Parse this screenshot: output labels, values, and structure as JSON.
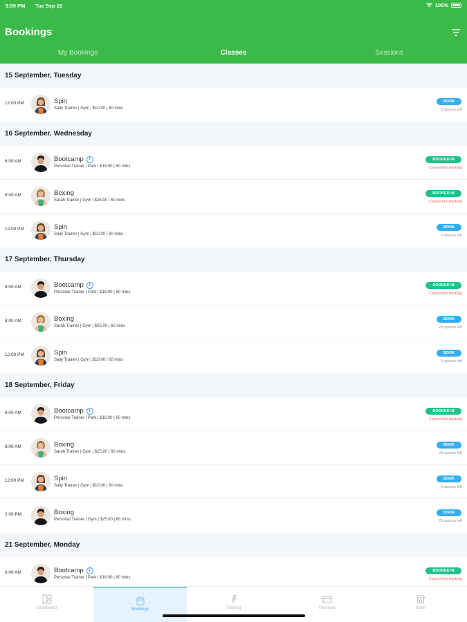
{
  "status_bar": {
    "time": "5:50 PM",
    "date": "Tue Sep 15",
    "battery": "100%"
  },
  "header": {
    "title": "Bookings"
  },
  "tabs": [
    {
      "label": "My Bookings",
      "active": false
    },
    {
      "label": "Classes",
      "active": true
    },
    {
      "label": "Sessions",
      "active": false
    }
  ],
  "days": [
    {
      "label": "15 September, Tuesday",
      "classes": [
        {
          "time": "12:00 PM",
          "name": "Spin",
          "details": "Sally Trainer | Gym | $10.00 | 60 mins",
          "avatar": "woman-orange",
          "info": false,
          "status": "book",
          "button": "BOOK",
          "sub": "5 spaces left"
        }
      ]
    },
    {
      "label": "16 September, Wednesday",
      "classes": [
        {
          "time": "6:00 AM",
          "name": "Bootcamp",
          "details": "Personal Trainer | Park | $18.00 | 60 mins",
          "avatar": "man-dark",
          "info": true,
          "status": "booked",
          "button": "BOOKED IN",
          "sub": "Cancel this booking"
        },
        {
          "time": "8:00 AM",
          "name": "Boxing",
          "details": "Sarah Trainer | Gym | $25.00 | 60 mins",
          "avatar": "woman-green",
          "info": false,
          "status": "booked",
          "button": "BOOKED IN",
          "sub": "Cancel this booking"
        },
        {
          "time": "12:00 PM",
          "name": "Spin",
          "details": "Sally Trainer | Gym | $10.00 | 60 mins",
          "avatar": "woman-orange",
          "info": false,
          "status": "book",
          "button": "BOOK",
          "sub": "5 spaces left"
        }
      ]
    },
    {
      "label": "17 September, Thursday",
      "classes": [
        {
          "time": "6:00 AM",
          "name": "Bootcamp",
          "details": "Personal Trainer | Park | $18.00 | 60 mins",
          "avatar": "man-dark",
          "info": true,
          "status": "booked",
          "button": "BOOKED IN",
          "sub": "Cancel this booking"
        },
        {
          "time": "8:00 AM",
          "name": "Boxing",
          "details": "Sarah Trainer | Gym | $25.00 | 60 mins",
          "avatar": "woman-green",
          "info": false,
          "status": "book",
          "button": "BOOK",
          "sub": "29 spaces left"
        },
        {
          "time": "12:00 PM",
          "name": "Spin",
          "details": "Sally Trainer | Gym | $10.00 | 60 mins",
          "avatar": "woman-orange",
          "info": false,
          "status": "book",
          "button": "BOOK",
          "sub": "5 spaces left"
        }
      ]
    },
    {
      "label": "18 September, Friday",
      "classes": [
        {
          "time": "6:00 AM",
          "name": "Bootcamp",
          "details": "Personal Trainer | Park | $18.00 | 60 mins",
          "avatar": "man-dark",
          "info": true,
          "status": "booked",
          "button": "BOOKED IN",
          "sub": "Cancel this booking"
        },
        {
          "time": "8:00 AM",
          "name": "Boxing",
          "details": "Sarah Trainer | Gym | $25.00 | 60 mins",
          "avatar": "woman-green",
          "info": false,
          "status": "book",
          "button": "BOOK",
          "sub": "29 spaces left"
        },
        {
          "time": "12:00 PM",
          "name": "Spin",
          "details": "Sally Trainer | Gym | $10.00 | 60 mins",
          "avatar": "woman-orange",
          "info": false,
          "status": "book",
          "button": "BOOK",
          "sub": "5 spaces left"
        },
        {
          "time": "2:00 PM",
          "name": "Boxing",
          "details": "Personal Trainer | Gym | $25.00 | 60 mins",
          "avatar": "man-dark",
          "info": false,
          "status": "book",
          "button": "BOOK",
          "sub": "25 spaces left"
        }
      ]
    },
    {
      "label": "21 September, Monday",
      "classes": [
        {
          "time": "6:00 AM",
          "name": "Bootcamp",
          "details": "Personal Trainer | Park | $18.00 | 60 mins",
          "avatar": "man-dark",
          "info": true,
          "status": "booked",
          "button": "BOOKED IN",
          "sub": "Cancel this booking"
        }
      ]
    }
  ],
  "bottom_nav": [
    {
      "label": "Dashboard",
      "icon": "dashboard-icon",
      "active": false
    },
    {
      "label": "Bookings",
      "icon": "calendar-icon",
      "active": true
    },
    {
      "label": "Training",
      "icon": "training-icon",
      "active": false
    },
    {
      "label": "Finances",
      "icon": "finances-icon",
      "active": false
    },
    {
      "label": "Store",
      "icon": "store-icon",
      "active": false
    }
  ],
  "colors": {
    "header": "#3cba49",
    "book": "#34aef0",
    "booked": "#22c08a",
    "cancel": "#f2625e",
    "day_header_bg": "#f3f6fb"
  }
}
